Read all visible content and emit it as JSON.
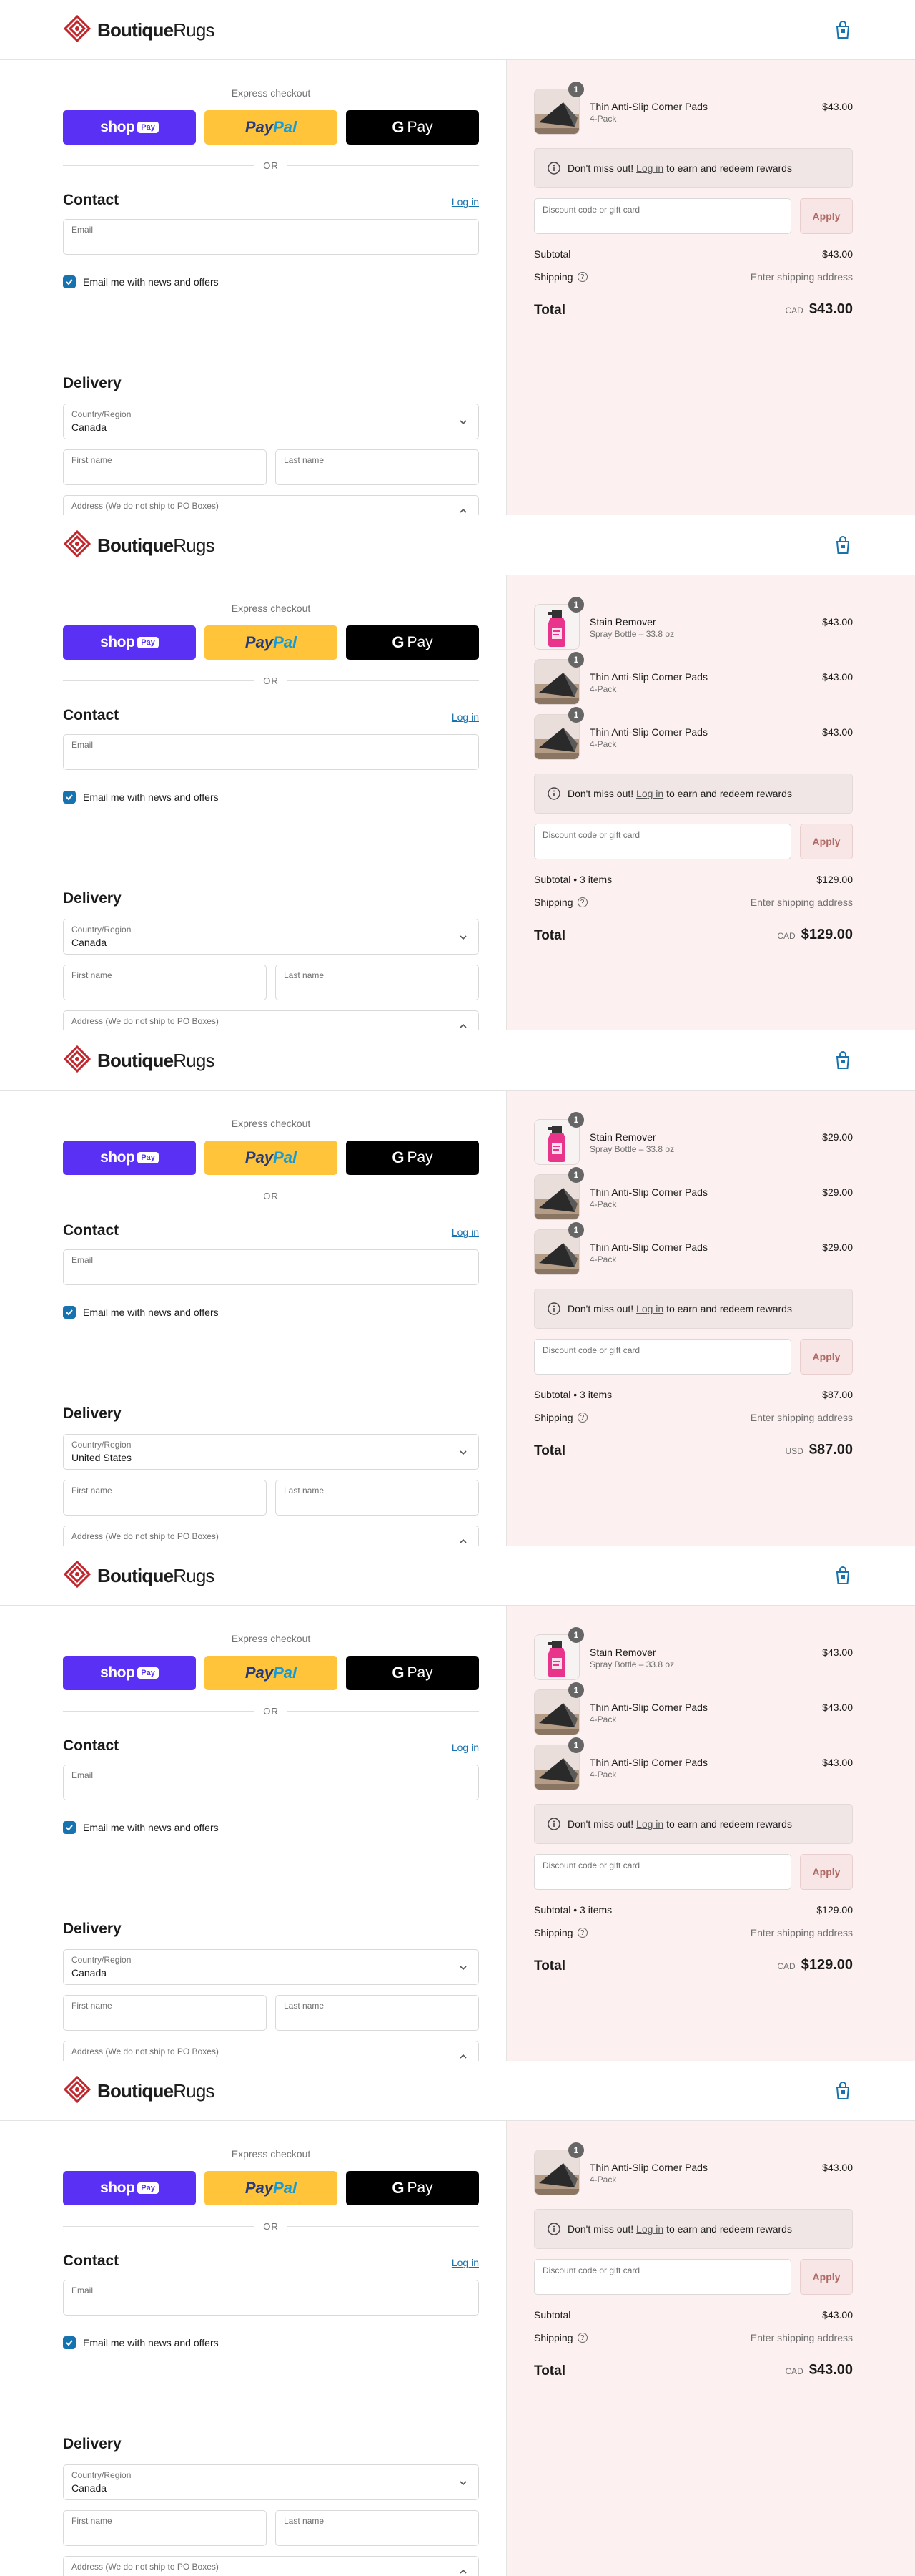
{
  "brand": {
    "name_bold": "Boutique",
    "name_light": "Rugs",
    "logo_color": "#c0272d"
  },
  "express": {
    "title": "Express checkout",
    "shop_label": "shop",
    "shop_tag": "Pay",
    "paypal_a": "Pay",
    "paypal_b": "Pal",
    "gpay_g": "G",
    "gpay_label": "Pay",
    "or_label": "OR"
  },
  "contact": {
    "title": "Contact",
    "login_label": "Log in",
    "email_label": "Email",
    "newsletter_label": "Email me with news and offers"
  },
  "delivery": {
    "title": "Delivery",
    "country_label": "Country/Region",
    "first_name_label": "First name",
    "last_name_label": "Last name",
    "address_label": "Address (We do not ship to PO Boxes)"
  },
  "summary_labels": {
    "rewards_prefix": "Don't miss out!",
    "rewards_link": "Log in",
    "rewards_suffix": "to earn and redeem rewards",
    "discount_placeholder": "Discount code or gift card",
    "apply_label": "Apply",
    "shipping_label": "Shipping",
    "shipping_value": "Enter shipping address",
    "total_label": "Total"
  },
  "panels": [
    {
      "country": "Canada",
      "items": [
        {
          "qty": "1",
          "name": "Thin Anti-Slip Corner Pads",
          "variant": "4-Pack",
          "price": "$43.00",
          "kind": "pads"
        }
      ],
      "subtotal_label": "Subtotal",
      "subtotal": "$43.00",
      "currency": "CAD",
      "total": "$43.00"
    },
    {
      "country": "Canada",
      "items": [
        {
          "qty": "1",
          "name": "Stain Remover",
          "variant": "Spray Bottle – 33.8 oz",
          "price": "$43.00",
          "kind": "spray"
        },
        {
          "qty": "1",
          "name": "Thin Anti-Slip Corner Pads",
          "variant": "4-Pack",
          "price": "$43.00",
          "kind": "pads"
        },
        {
          "qty": "1",
          "name": "Thin Anti-Slip Corner Pads",
          "variant": "4-Pack",
          "price": "$43.00",
          "kind": "pads"
        }
      ],
      "subtotal_label": "Subtotal • 3 items",
      "subtotal": "$129.00",
      "currency": "CAD",
      "total": "$129.00"
    },
    {
      "country": "United States",
      "items": [
        {
          "qty": "1",
          "name": "Stain Remover",
          "variant": "Spray Bottle – 33.8 oz",
          "price": "$29.00",
          "kind": "spray"
        },
        {
          "qty": "1",
          "name": "Thin Anti-Slip Corner Pads",
          "variant": "4-Pack",
          "price": "$29.00",
          "kind": "pads"
        },
        {
          "qty": "1",
          "name": "Thin Anti-Slip Corner Pads",
          "variant": "4-Pack",
          "price": "$29.00",
          "kind": "pads"
        }
      ],
      "subtotal_label": "Subtotal • 3 items",
      "subtotal": "$87.00",
      "currency": "USD",
      "total": "$87.00"
    },
    {
      "country": "Canada",
      "items": [
        {
          "qty": "1",
          "name": "Stain Remover",
          "variant": "Spray Bottle – 33.8 oz",
          "price": "$43.00",
          "kind": "spray"
        },
        {
          "qty": "1",
          "name": "Thin Anti-Slip Corner Pads",
          "variant": "4-Pack",
          "price": "$43.00",
          "kind": "pads"
        },
        {
          "qty": "1",
          "name": "Thin Anti-Slip Corner Pads",
          "variant": "4-Pack",
          "price": "$43.00",
          "kind": "pads"
        }
      ],
      "subtotal_label": "Subtotal • 3 items",
      "subtotal": "$129.00",
      "currency": "CAD",
      "total": "$129.00"
    },
    {
      "country": "Canada",
      "items": [
        {
          "qty": "1",
          "name": "Thin Anti-Slip Corner Pads",
          "variant": "4-Pack",
          "price": "$43.00",
          "kind": "pads"
        }
      ],
      "subtotal_label": "Subtotal",
      "subtotal": "$43.00",
      "currency": "CAD",
      "total": "$43.00"
    }
  ]
}
